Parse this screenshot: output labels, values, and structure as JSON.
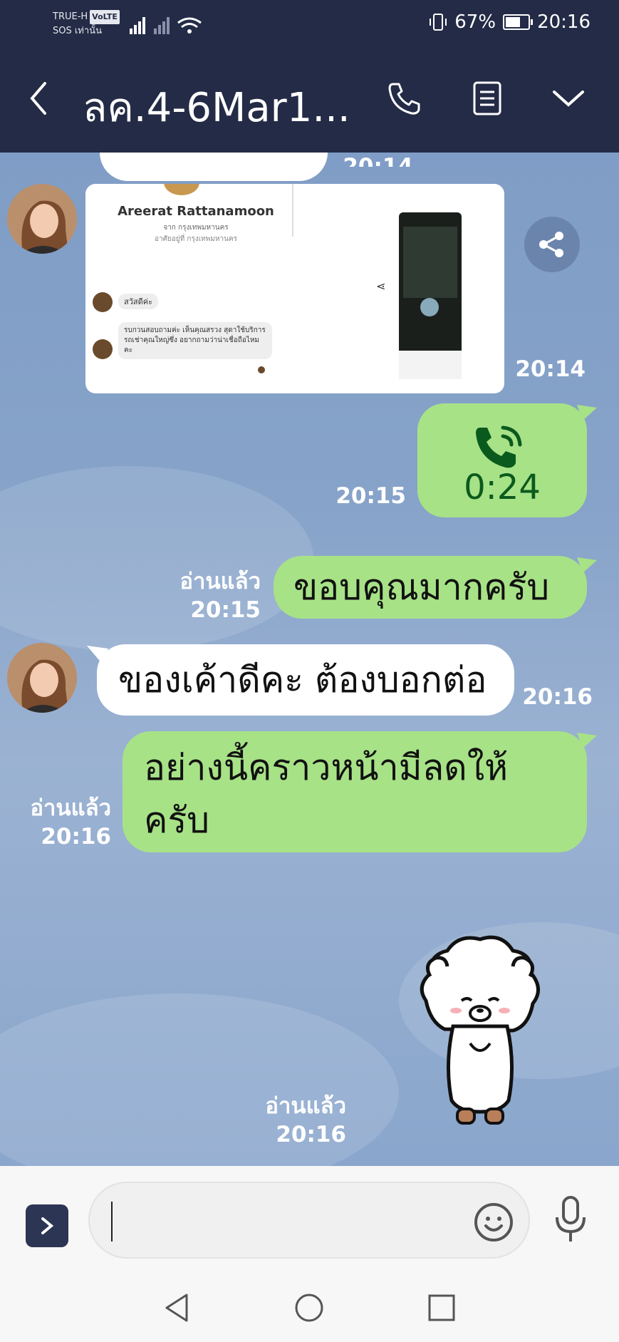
{
  "status_bar": {
    "carrier": "TRUE-H",
    "volte": "VoLTE",
    "sos": "SOS เท่านั้น",
    "battery": "67%",
    "battery_level": 0.67,
    "time": "20:16"
  },
  "header": {
    "title": "ลค.4-6Mar1...",
    "icons": [
      "back-arrow-icon",
      "phone-icon",
      "notes-icon",
      "chevron-down-icon"
    ]
  },
  "messages": {
    "top_time_partial": "20:14",
    "screenshot": {
      "name": "Areerat Rattanamoon",
      "sub1": "จาก กรุงเทพมหานคร",
      "sub2": "อาศัยอยู่ที่ กรุงเทพมหานคร",
      "greeting": "สวัสดีค่ะ",
      "msg": "รบกวนสอบถามค่ะ เห็นคุณสรวง สุดาใช้บริการรถเช่าคุณใหญ่ซึ่ง อยากถามว่าน่าเชื่อถือไหมคะ",
      "time": "20:14"
    },
    "call": {
      "duration": "0:24",
      "time": "20:15"
    },
    "msg1": {
      "text": "ขอบคุณมากครับ",
      "read": "อ่านแล้ว",
      "time": "20:15"
    },
    "msg2": {
      "text": "ของเค้าดีคะ ต้องบอกต่อ",
      "time": "20:16"
    },
    "msg3": {
      "line1": "อย่างนี้คราวหน้ามีลดให้",
      "line2": "ครับ",
      "read": "อ่านแล้ว",
      "time": "20:16"
    },
    "sticker": {
      "read": "อ่านแล้ว",
      "time": "20:16"
    }
  },
  "colors": {
    "header": "#232b46",
    "outgoing": "#a7e287",
    "incoming": "#ffffff",
    "chat_bg": "#87a3c9"
  }
}
